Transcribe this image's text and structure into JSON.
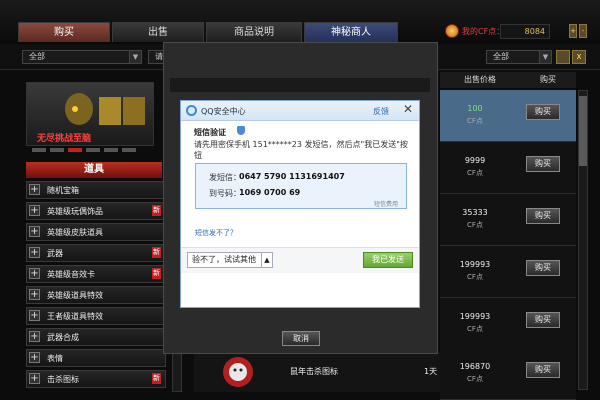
{
  "tabs": [
    {
      "label": "购买"
    },
    {
      "label": "出售"
    },
    {
      "label": "商品说明"
    },
    {
      "label": "神秘商人"
    }
  ],
  "account": {
    "cf_label": "我的CF点：",
    "cf_value": "8084",
    "plus_glyph": "+",
    "minus_glyph": "-"
  },
  "filters": {
    "left_select": "全部",
    "mid_select": "请",
    "right_select": "全部",
    "close_glyph": "X"
  },
  "banner": {
    "text": "无尽挑战至脑"
  },
  "categories": {
    "header": "道具",
    "items": [
      {
        "label": "随机宝箱",
        "new": ""
      },
      {
        "label": "英雄级玩偶饰品",
        "new": "新"
      },
      {
        "label": "英雄级皮肤道具",
        "new": ""
      },
      {
        "label": "武器",
        "new": "新"
      },
      {
        "label": "英雄级音效卡",
        "new": "新"
      },
      {
        "label": "英雄级道具特效",
        "new": ""
      },
      {
        "label": "王者级道具特效",
        "new": ""
      },
      {
        "label": "武器合成",
        "new": ""
      },
      {
        "label": "表情",
        "new": ""
      },
      {
        "label": "击杀图标",
        "new": "新"
      }
    ]
  },
  "market": {
    "col_price": "出售价格",
    "col_buy": "购买",
    "rows": [
      {
        "price": "100",
        "unit": "CF点",
        "buy": "购买"
      },
      {
        "price": "9999",
        "unit": "CF点",
        "buy": "购买"
      },
      {
        "price": "35333",
        "unit": "CF点",
        "buy": "购买"
      },
      {
        "price": "199993",
        "unit": "CF点",
        "buy": "购买"
      },
      {
        "price": "199993",
        "unit": "CF点",
        "buy": "购买"
      },
      {
        "price": "196870",
        "unit": "CF点",
        "buy": "购买"
      }
    ],
    "bottom_item_name": "鼠年击杀图标",
    "bottom_item_days": "1天"
  },
  "overlay": {
    "cancel": "取消"
  },
  "qq_dialog": {
    "title": "QQ安全中心",
    "feedback": "反馈",
    "close_glyph": "✕",
    "section_label": "短信验证",
    "description": "请先用密保手机 151******23 发短信，然后点\"我已发送\"按钮",
    "send_label": "发短信：",
    "send_value": "0647 5790 1131691407",
    "to_label": "到号码：",
    "to_value": "1069 0700 69",
    "fee": "短信费用",
    "help": "短信发不了？",
    "fail_btn": "验不了，试试其他",
    "sent_btn": "我已发送"
  }
}
